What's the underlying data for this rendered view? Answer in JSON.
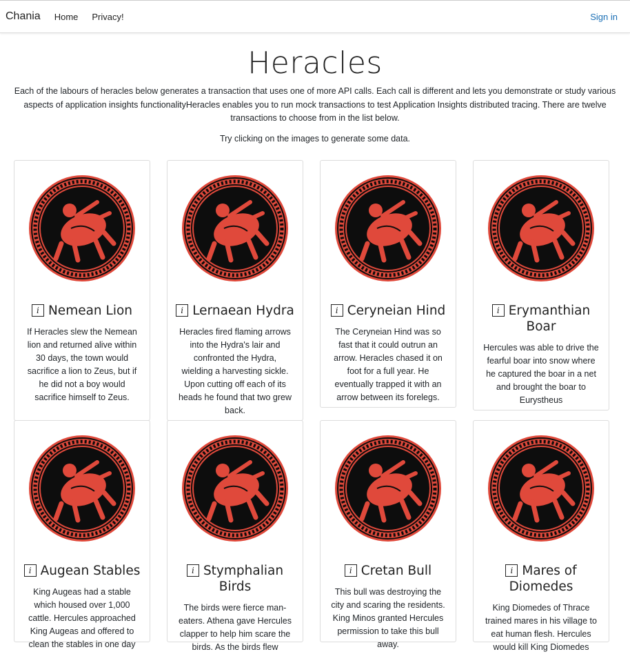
{
  "nav": {
    "brand": "Chania",
    "links": [
      "Home",
      "Privacy!"
    ],
    "signin": "Sign in"
  },
  "page": {
    "title": "Heracles",
    "intro": "Each of the labours of heracles below generates a transaction that uses one of more API calls. Each call is different and lets you demonstrate or study various aspects of application insights functionalityHeracles enables you to run mock transactions to test Application Insights distributed tracing. There are twelve transactions to choose from in the list below.",
    "hint": "Try clicking on the images to generate some data."
  },
  "info_icon": "i",
  "colors": {
    "emblem_red": "#e0493b",
    "emblem_dark": "#0d0d0d",
    "link": "#1a6fb5"
  },
  "labours": [
    {
      "title": "Nemean Lion",
      "icon": "lion-emblem-icon",
      "text": "If Heracles slew the Nemean lion and returned alive within 30 days, the town would sacrifice a lion to Zeus, but if he did not a boy would sacrifice himself to Zeus."
    },
    {
      "title": "Lernaean Hydra",
      "icon": "hydra-emblem-icon",
      "text": "Heracles fired flaming arrows into the Hydra's lair and confronted the Hydra, wielding a harvesting sickle. Upon cutting off each of its heads he found that two grew back."
    },
    {
      "title": "Ceryneian Hind",
      "icon": "hind-emblem-icon",
      "text": "The Ceryneian Hind was so fast that it could outrun an arrow. Heracles chased it on foot for a full year. He eventually trapped it with an arrow between its forelegs."
    },
    {
      "title": "Erymanthian Boar",
      "icon": "boar-emblem-icon",
      "text": "Hercules was able to drive the fearful boar into snow where he captured the boar in a net and brought the boar to Eurystheus"
    },
    {
      "title": "Augean Stables",
      "icon": "stables-emblem-icon",
      "text": "King Augeas had a stable which housed over 1,000 cattle. Hercules approached King Augeas and offered to clean the stables in one day"
    },
    {
      "title": "Stymphalian Birds",
      "icon": "birds-emblem-icon",
      "text": "The birds were fierce man-eaters. Athena gave Hercules clapper to help him scare the birds. As the birds flew"
    },
    {
      "title": "Cretan Bull",
      "icon": "bull-emblem-icon",
      "text": "This bull was destroying the city and scaring the residents. King Minos granted Hercules permission to take this bull away."
    },
    {
      "title": "Mares of Diomedes",
      "icon": "mares-emblem-icon",
      "text": "King Diomedes of Thrace trained mares in his village to eat human flesh. Hercules would kill King Diomedes"
    }
  ]
}
